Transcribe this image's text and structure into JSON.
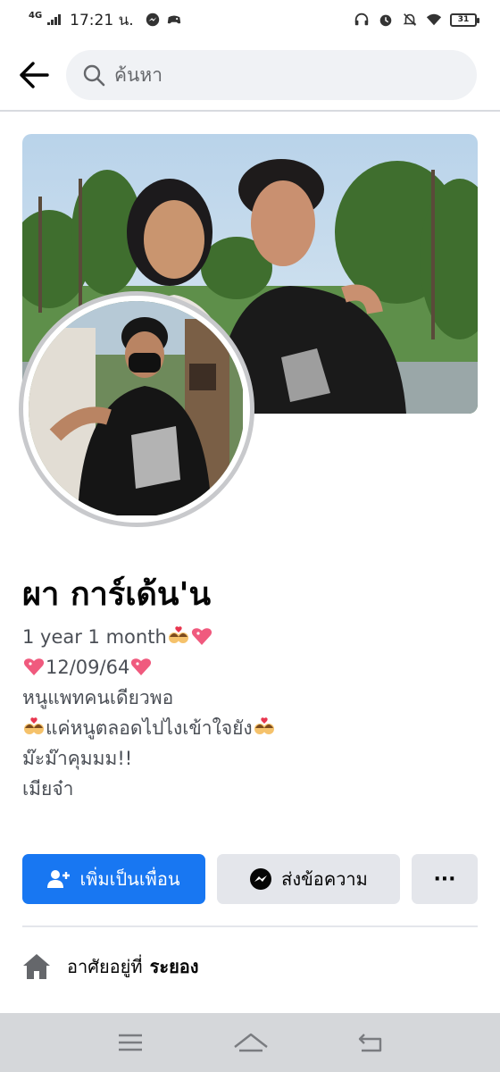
{
  "status_bar": {
    "network": "4G",
    "time": "17:21 น.",
    "battery": "31",
    "icons": [
      "messenger-icon",
      "game-icon",
      "headphones-icon",
      "alarm-icon",
      "mute-bell-icon",
      "wifi-icon",
      "battery-icon"
    ]
  },
  "header": {
    "search_placeholder": "ค้นหา"
  },
  "profile": {
    "name": "ผา การ์เด้น'น",
    "bio": {
      "line1": "1 year 1 month",
      "line2": "12/09/64",
      "line3": "หนูแพทคนเดียวพอ",
      "line4": "แค่หนูตลอดไปไงเข้าใจยัง",
      "line5": "ม๊ะม๊าคุมมม!!",
      "line6": "เมียจ๋า"
    }
  },
  "actions": {
    "add_friend": "เพิ่มเป็นเพื่อน",
    "message": "ส่งข้อความ",
    "more": "···"
  },
  "details": {
    "lives_in_label": "อาศัยอยู่ที่",
    "lives_in_value": "ระยอง"
  },
  "colors": {
    "accent": "#1877f2",
    "button_gray": "#e4e6eb",
    "nav_bg": "#d5d7da"
  }
}
